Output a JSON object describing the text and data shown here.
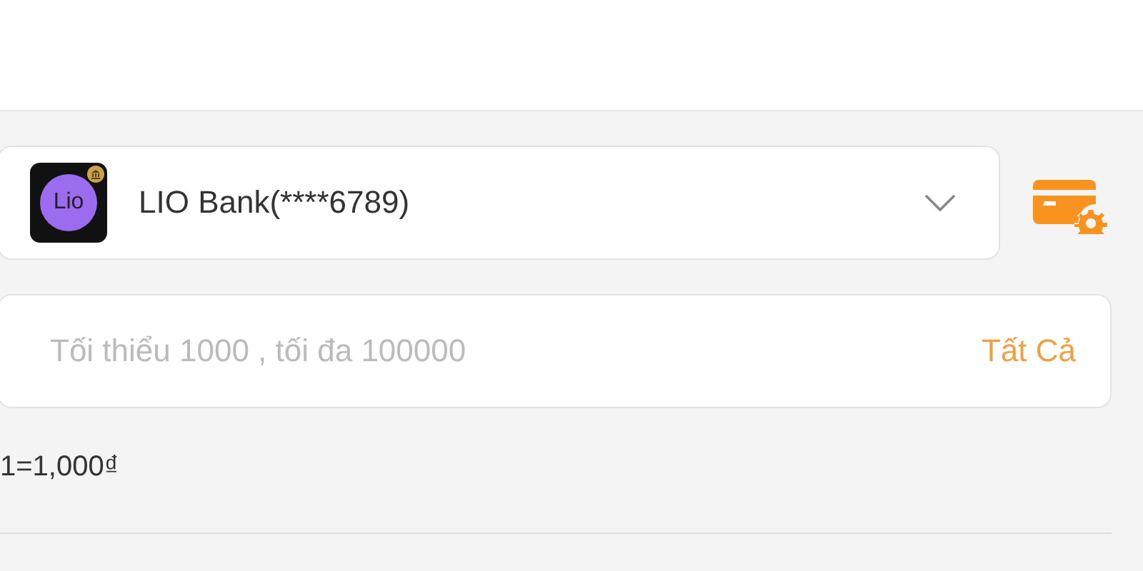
{
  "bank_select": {
    "logo_text": "Lio",
    "label": "LIO Bank(****6789)"
  },
  "amount_field": {
    "placeholder": "Tối thiểu 1000 , tối đa 100000",
    "all_button": "Tất Cả"
  },
  "rate": "1=1,000₫"
}
